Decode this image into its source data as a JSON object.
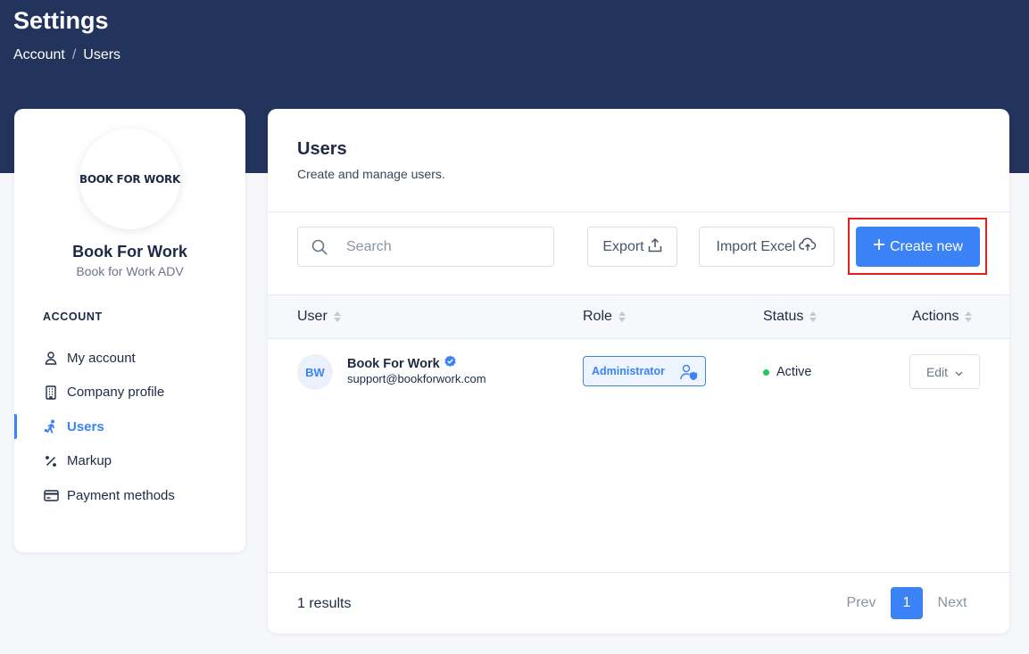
{
  "header": {
    "title": "Settings",
    "breadcrumb": [
      "Account",
      "Users"
    ],
    "breadcrumb_sep": "/"
  },
  "sidebar": {
    "logo_text": "BOOK FOR WORK",
    "company_name": "Book For Work",
    "company_sub": "Book for Work ADV",
    "section_label": "ACCOUNT",
    "items": [
      {
        "label": "My account",
        "icon": "user-icon",
        "active": false
      },
      {
        "label": "Company profile",
        "icon": "building-icon",
        "active": false
      },
      {
        "label": "Users",
        "icon": "users-icon",
        "active": true
      },
      {
        "label": "Markup",
        "icon": "percent-icon",
        "active": false
      },
      {
        "label": "Payment methods",
        "icon": "credit-card-icon",
        "active": false
      }
    ]
  },
  "main": {
    "title": "Users",
    "subtitle": "Create and manage users.",
    "search": {
      "placeholder": "Search",
      "value": ""
    },
    "export_label": "Export",
    "import_label": "Import Excel",
    "create_label": "Create new",
    "columns": [
      "User",
      "Role",
      "Status",
      "Actions"
    ],
    "rows": [
      {
        "initials": "BW",
        "name": "Book For Work",
        "email": "support@bookforwork.com",
        "role": "Administrator",
        "status": "Active",
        "action": "Edit"
      }
    ],
    "results_text": "1 results",
    "pagination": {
      "prev": "Prev",
      "current": "1",
      "next": "Next"
    }
  },
  "colors": {
    "header_bg": "#23345c",
    "accent": "#3b82f6",
    "status_active": "#22c55e",
    "highlight_outline": "#e02020"
  }
}
